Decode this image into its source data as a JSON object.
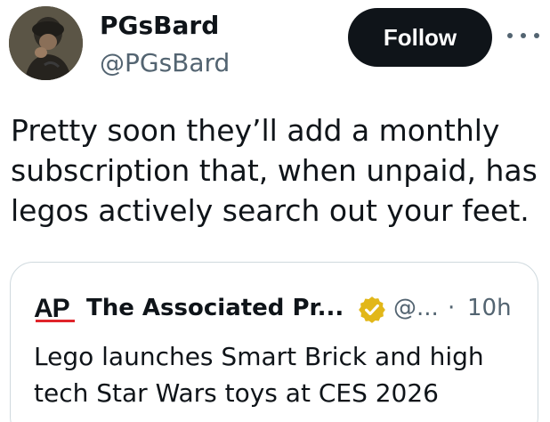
{
  "tweet": {
    "author": {
      "display_name": "PGsBard",
      "handle": "@PGsBard"
    },
    "follow_label": "Follow",
    "text": "Pretty soon they’ll add a monthly subscription that, when unpaid, has legos actively search out your feet."
  },
  "quoted_tweet": {
    "logo_text": "AP",
    "display_name": "The Associated Pr...",
    "handle": "@...",
    "separator": "·",
    "time": "10h",
    "text": "Lego launches Smart Brick and high tech Star Wars toys at CES 2026",
    "verified_color": "#e2b719",
    "logo_accent_color": "#e0242b"
  },
  "colors": {
    "text_primary": "#0f1419",
    "text_secondary": "#536471",
    "border": "#cfd9de"
  },
  "icons": [
    "avatar-image",
    "more-options-icon",
    "ap-logo",
    "verified-badge-icon"
  ]
}
